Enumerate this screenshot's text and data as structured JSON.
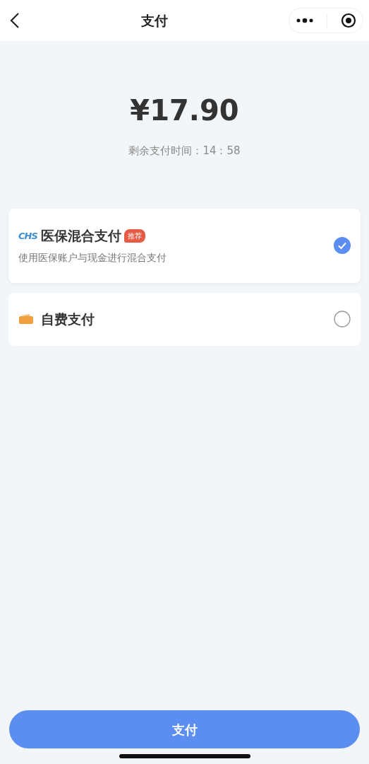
{
  "header": {
    "title": "支付"
  },
  "amount": "¥17.90",
  "countdown": {
    "label": "剩余支付时间：",
    "time": "14：58"
  },
  "options": [
    {
      "kind": "insurance",
      "logo_text": "CHS",
      "title": "医保混合支付",
      "badge": "推荐",
      "subtitle": "使用医保账户与现金进行混合支付",
      "selected": true
    },
    {
      "kind": "wallet",
      "title": "自费支付",
      "selected": false
    }
  ],
  "pay_button": "支付"
}
